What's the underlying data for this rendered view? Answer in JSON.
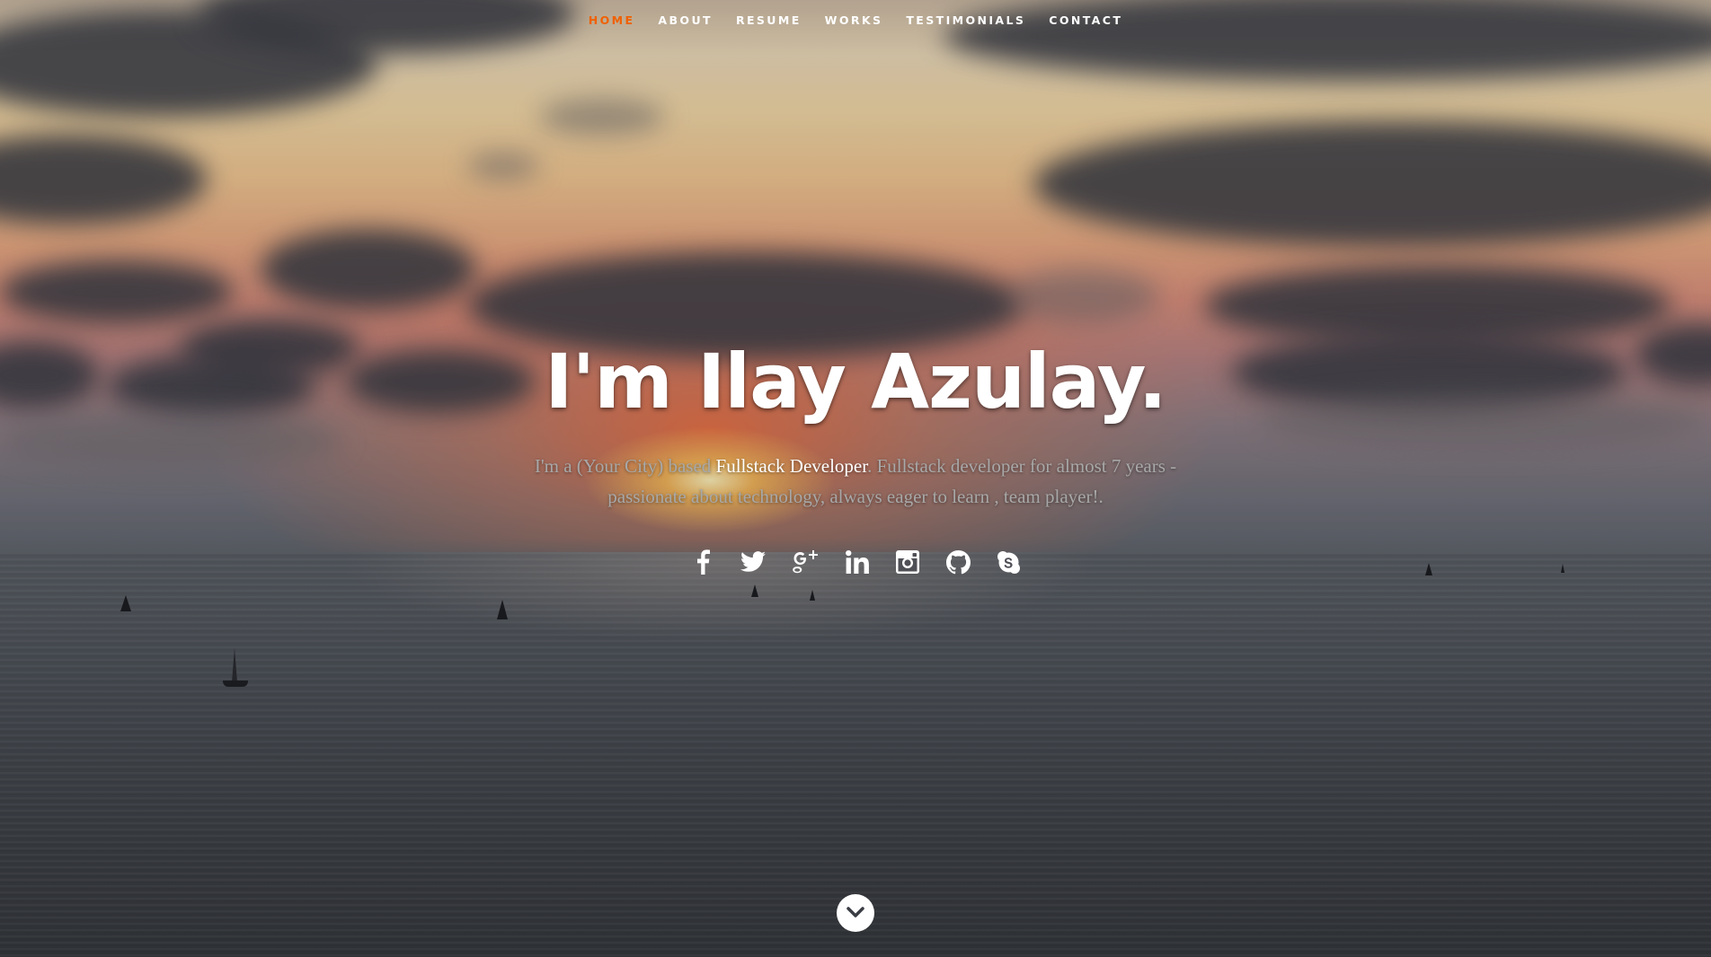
{
  "nav": {
    "items": [
      {
        "label": "HOME",
        "active": true
      },
      {
        "label": "ABOUT",
        "active": false
      },
      {
        "label": "RESUME",
        "active": false
      },
      {
        "label": "WORKS",
        "active": false
      },
      {
        "label": "TESTIMONIALS",
        "active": false
      },
      {
        "label": "CONTACT",
        "active": false
      }
    ],
    "active_color": "#f06000",
    "color": "#ffffff"
  },
  "hero": {
    "title": "I'm Ilay Azulay.",
    "bio_part1": "I'm a (Your City) based ",
    "bio_highlight": "Fullstack Developer",
    "bio_part2": ". Fullstack developer for almost 7 years - passionate about technology, always eager to learn , team player!."
  },
  "social": [
    {
      "icon": "facebook-icon"
    },
    {
      "icon": "twitter-icon"
    },
    {
      "icon": "google-plus-icon"
    },
    {
      "icon": "linkedin-icon"
    },
    {
      "icon": "instagram-icon"
    },
    {
      "icon": "github-icon"
    },
    {
      "icon": "skype-icon"
    }
  ],
  "scroll_down": {
    "icon": "chevron-down-icon"
  }
}
